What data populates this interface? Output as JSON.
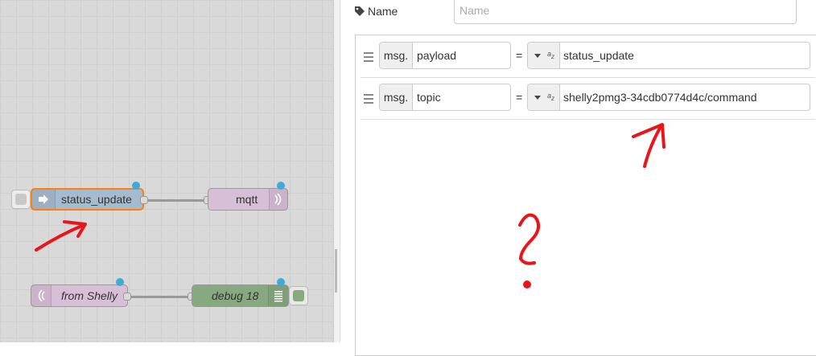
{
  "canvas": {
    "nodes": {
      "inject": {
        "label": "status_update"
      },
      "mqtt_out": {
        "label": "mqtt"
      },
      "mqtt_in": {
        "label": "from Shelly"
      },
      "debug": {
        "label": "debug 18"
      }
    },
    "status_color": "#3fa9d8"
  },
  "editor": {
    "name_label": "Name",
    "name_placeholder": "Name",
    "rules": [
      {
        "prefix": "msg.",
        "property": "payload",
        "operator": "=",
        "type_icon": "az-string-icon",
        "value": "status_update"
      },
      {
        "prefix": "msg.",
        "property": "topic",
        "operator": "=",
        "type_icon": "az-string-icon",
        "value": "shelly2pmg3-34cdb0774d4c/command"
      }
    ]
  },
  "annotations": {
    "mark_text": "?",
    "color": "#e8161b"
  }
}
